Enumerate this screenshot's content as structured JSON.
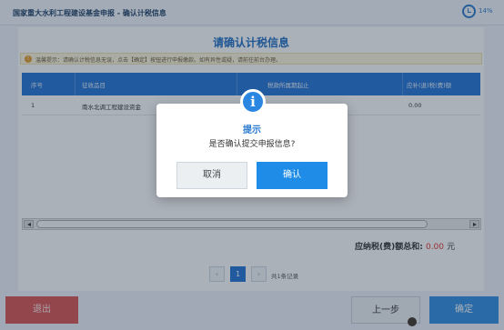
{
  "window": {
    "title": "国家重大水利工程建设基金申报 - 确认计税信息",
    "battery_percent": "14%"
  },
  "main": {
    "heading": "请确认计税信息",
    "tip_icon": "!",
    "tip_text": "温馨提示：请确认计税信息无误，点击【确定】按钮进行申报缴款。如有异性或疑，请前往前台办理。",
    "table": {
      "columns": [
        "序号",
        "征收品目",
        "税款所属期起止",
        "应补(退)税(费)额"
      ],
      "rows": [
        {
          "index": "1",
          "item": "南水北调工程建设资金",
          "period": "",
          "amount": "0.00"
        }
      ]
    },
    "total_label": "应纳税(费)额总和:",
    "total_amount": "0.00",
    "total_unit": "元"
  },
  "pager": {
    "prev": "‹",
    "current_page": "1",
    "next": "›",
    "summary": "共1条记录"
  },
  "footer": {
    "exit_label": "退出",
    "prev_label": "上一步",
    "confirm_label": "确定"
  },
  "dialog": {
    "icon": "i",
    "title": "提示",
    "message": "是否确认提交申报信息?",
    "cancel_label": "取消",
    "ok_label": "确认"
  },
  "colors": {
    "primary_blue": "#2173d6",
    "danger_red": "#d9534f",
    "amount_red": "#e0302b"
  }
}
